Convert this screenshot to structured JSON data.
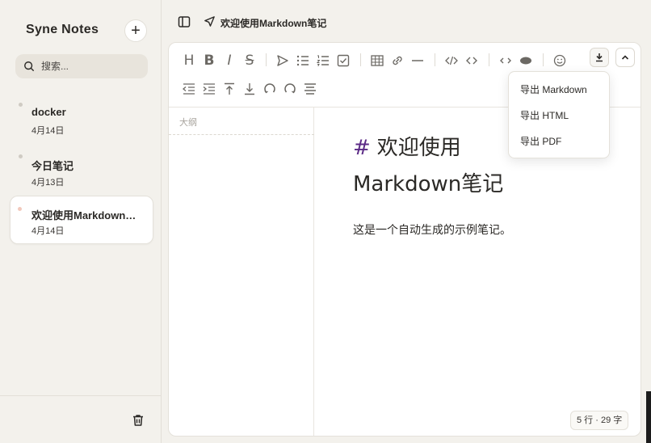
{
  "sidebar": {
    "app_title": "Syne Notes",
    "new_note_label": "+",
    "search_placeholder": "搜索...",
    "notes": [
      {
        "title": "docker",
        "date": "4月14日"
      },
      {
        "title": "今日笔记",
        "date": "4月13日"
      },
      {
        "title": "欢迎使用Markdown笔记",
        "date": "4月14日",
        "active": true
      }
    ]
  },
  "header": {
    "doc_title": "欢迎使用Markdown笔记"
  },
  "toolbar": {
    "letters": {
      "heading": "H",
      "bold": "B",
      "italic": "I",
      "strike": "S"
    },
    "icons": [
      "heading-icon",
      "bold-icon",
      "italic-icon",
      "strikethrough-icon",
      "send-icon",
      "bullet-list-icon",
      "ordered-list-icon",
      "checkbox-icon",
      "table-icon",
      "link-icon",
      "horizontal-rule-icon",
      "code-block-icon",
      "inline-code-icon",
      "collapse-arrows-icon",
      "preview-eye-icon",
      "emoji-icon",
      "export-download-icon",
      "collapse-up-icon",
      "outdent-icon",
      "indent-icon",
      "move-top-icon",
      "move-bottom-icon",
      "undo-icon",
      "redo-icon",
      "align-icon"
    ]
  },
  "outline": {
    "label": "大纲"
  },
  "document": {
    "heading_marker": "#",
    "heading_text": "欢迎使用 Markdown笔记",
    "paragraph": "这是一个自动生成的示例笔记。"
  },
  "status": {
    "text": "5 行 · 29 字"
  },
  "export_menu": {
    "items": [
      "导出 Markdown",
      "导出 HTML",
      "导出 PDF"
    ]
  },
  "colors": {
    "background": "#f3f1ec",
    "card": "#ffffff",
    "heading_hash": "#5b2a86",
    "text": "#2b2926",
    "icon": "#6b6863"
  }
}
